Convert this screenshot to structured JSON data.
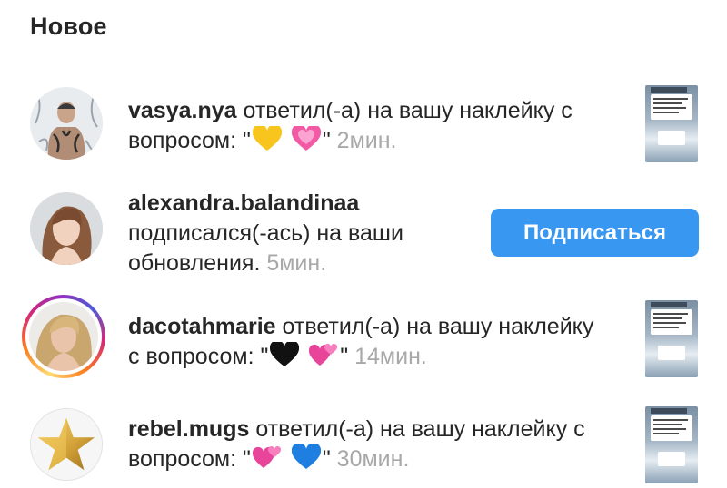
{
  "header": {
    "title": "Новое"
  },
  "notifications": [
    {
      "username": "vasya.nya",
      "text_before": " ответил(-а) на вашу наклейку с вопросом: \"",
      "emoji_1": "yellow-heart",
      "emoji_2": "sparkling-heart",
      "text_after": "\" ",
      "time": "2мин.",
      "has_thumbnail": true
    },
    {
      "username": "alexandra.balandinaa",
      "text_before": "подписался(-ась) на ваши обновления.",
      "time": "5мин.",
      "button_label": "Подписаться"
    },
    {
      "username": "dacotahmarie",
      "text_before": " ответил(-а) на вашу наклейку с вопросом: \"",
      "emoji_1": "black-heart",
      "emoji_2": "two-hearts",
      "text_after": "\" ",
      "time": "14мин.",
      "has_thumbnail": true,
      "story_ring": true
    },
    {
      "username": "rebel.mugs",
      "text_before": " ответил(-а) на вашу наклейку с вопросом: \"",
      "emoji_1": "two-hearts",
      "emoji_2": "blue-heart",
      "text_after": "\" ",
      "time": "30мин.",
      "has_thumbnail": true
    }
  ],
  "colors": {
    "primary_text": "#262626",
    "secondary_text": "#a8a8a8",
    "follow_button": "#3897f0"
  }
}
